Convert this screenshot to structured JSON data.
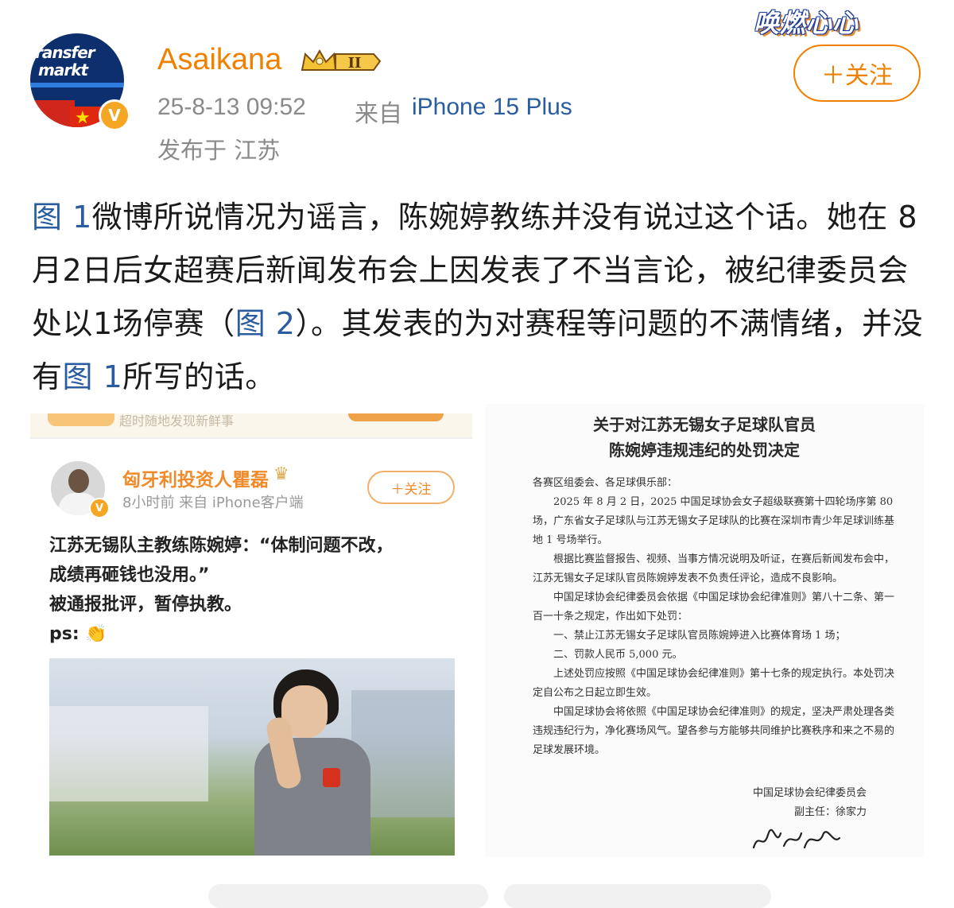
{
  "watermark": {
    "text": "唤燃心心"
  },
  "user": {
    "avatar_logo_line1": "ransfer",
    "avatar_logo_line2": "markt",
    "verified_badge": "V",
    "name": "Asaikana",
    "level_badge": "II",
    "time": "25-8-13 09:52",
    "from_label": "来自",
    "device": "iPhone 15 Plus",
    "location": "发布于 江苏"
  },
  "follow_button": {
    "label": "＋关注"
  },
  "post": {
    "seg1_link": "图 1",
    "seg2": "微博所说情况为谣言，陈婉婷教练并没有说过这个话。她在 8月2日后女超赛后新闻发布会上因发表了不当言论，被纪律委员会处以1场停赛（",
    "seg3_link": "图 2",
    "seg4": "）。其发表的为对赛程等问题的不满情绪，并没有",
    "seg5_link": "图 1",
    "seg6": "所写的话。"
  },
  "image1": {
    "top_ghost_text": "超时随地发现新鲜事",
    "author_name": "匈牙利投资人瞿磊",
    "author_meta": "8小时前  来自 iPhone客户端",
    "follow_label": "＋关注",
    "verified_badge": "V",
    "line1": "江苏无锡队主教练陈婉婷：“体制问题不改，",
    "line2": "成绩再砸钱也没用。”",
    "line3": "被通报批评，暂停执教。",
    "line4": "ps: 👏"
  },
  "image2": {
    "title_line1": "关于对江苏无锡女子足球队官员",
    "title_line2": "陈婉婷违规违纪的处罚决定",
    "salutation": "各赛区组委会、各足球俱乐部：",
    "para1": "2025 年 8 月 2 日，2025 中国足球协会女子超级联赛第十四轮场序第 80 场，广东省女子足球队与江苏无锡女子足球队的比赛在深圳市青少年足球训练基地 1 号场举行。",
    "para2": "根据比赛监督报告、视频、当事方情况说明及听证，在赛后新闻发布会中，江苏无锡女子足球队官员陈婉婷发表不负责任评论，造成不良影响。",
    "para3": "中国足球协会纪律委员会依据《中国足球协会纪律准则》第八十二条、第一百一十条之规定，作出如下处罚：",
    "item1": "一、禁止江苏无锡女子足球队官员陈婉婷进入比赛体育场 1 场；",
    "item2": "二、罚款人民币 5,000 元。",
    "para4": "上述处罚应按照《中国足球协会纪律准则》第十七条的规定执行。本处罚决定自公布之日起立即生效。",
    "para5": "中国足球协会将依照《中国足球协会纪律准则》的规定，坚决严肃处理各类违规违纪行为，净化赛场风气。望各参与方能够共同维护比赛秩序和来之不易的足球发展环境。",
    "sign_org": "中国足球协会纪律委员会",
    "sign_person": "副主任：徐家力",
    "signature_text": "徐家力"
  },
  "colors": {
    "accent": "#f08100",
    "link": "#2a5d9f",
    "meta": "#8a8a8a"
  }
}
